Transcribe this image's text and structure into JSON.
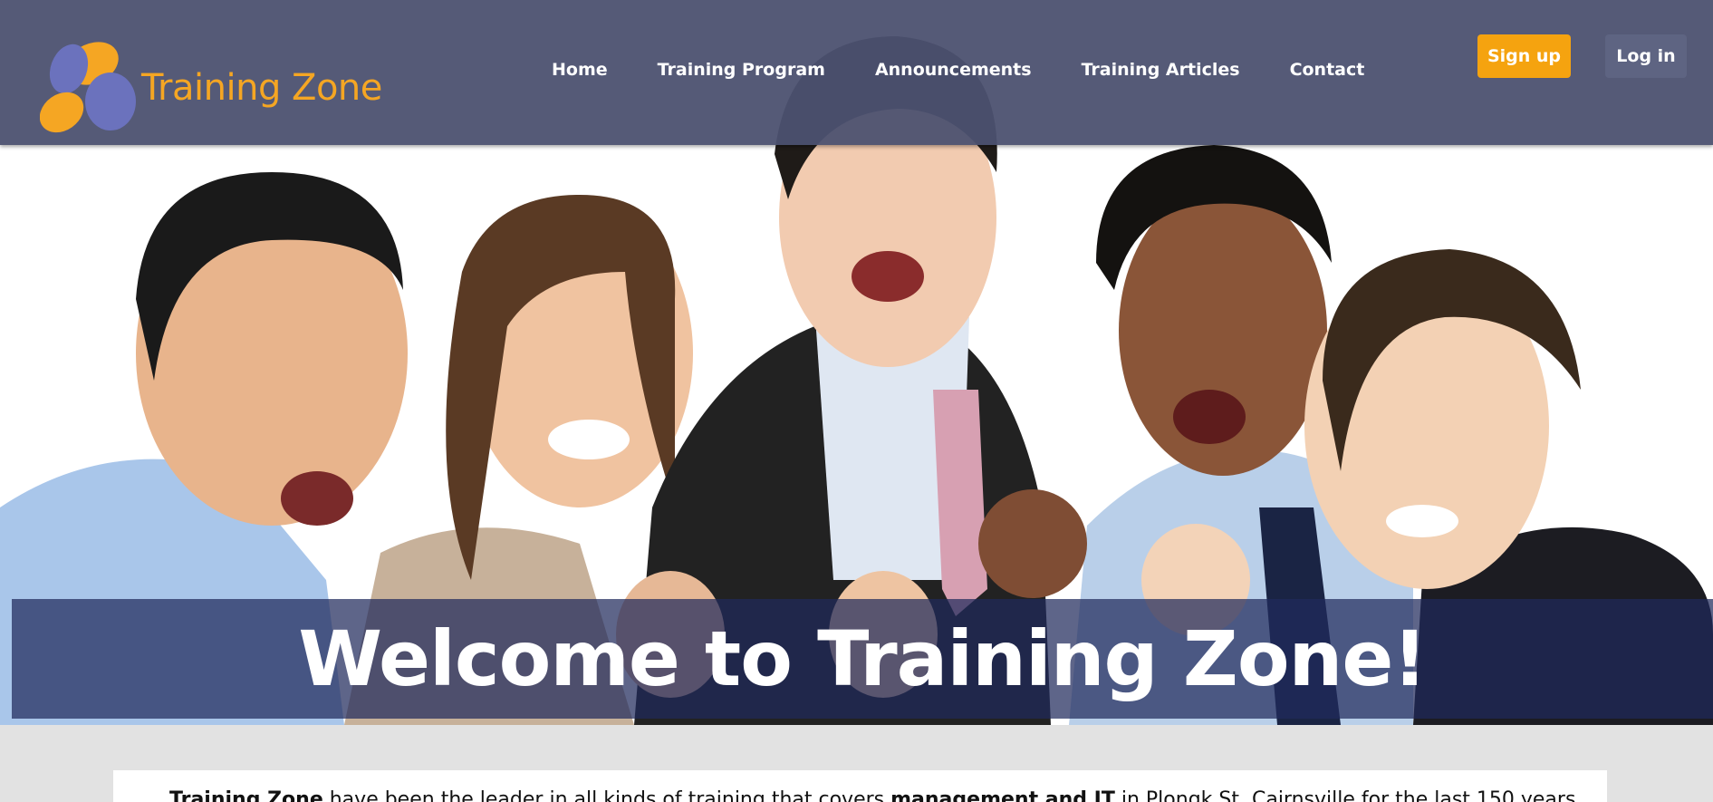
{
  "brand": {
    "name": "Training Zone",
    "accent": "#f5a623",
    "mark_secondary": "#6b72bd"
  },
  "nav": {
    "items": [
      {
        "label": "Home"
      },
      {
        "label": "Training Program"
      },
      {
        "label": "Announcements"
      },
      {
        "label": "Training Articles"
      },
      {
        "label": "Contact"
      }
    ]
  },
  "auth": {
    "signup_label": "Sign up",
    "login_label": "Log in"
  },
  "hero": {
    "image": "photo of five excited business people cheering",
    "headline": "Welcome to Training Zone!"
  },
  "intro": {
    "bold_name": "Training Zone",
    "text_1": " have been the leader in all kinds of training that covers ",
    "bold_topics": "management and IT",
    "text_2": " in Plongk St. Cairnsville for the last 150 years."
  },
  "colors": {
    "header_bg": "#4c5170",
    "signup_bg": "#f5a30f",
    "login_bg": "#5e6482",
    "banner_bg": "#202a5c",
    "page_bg": "#e2e2e2"
  }
}
